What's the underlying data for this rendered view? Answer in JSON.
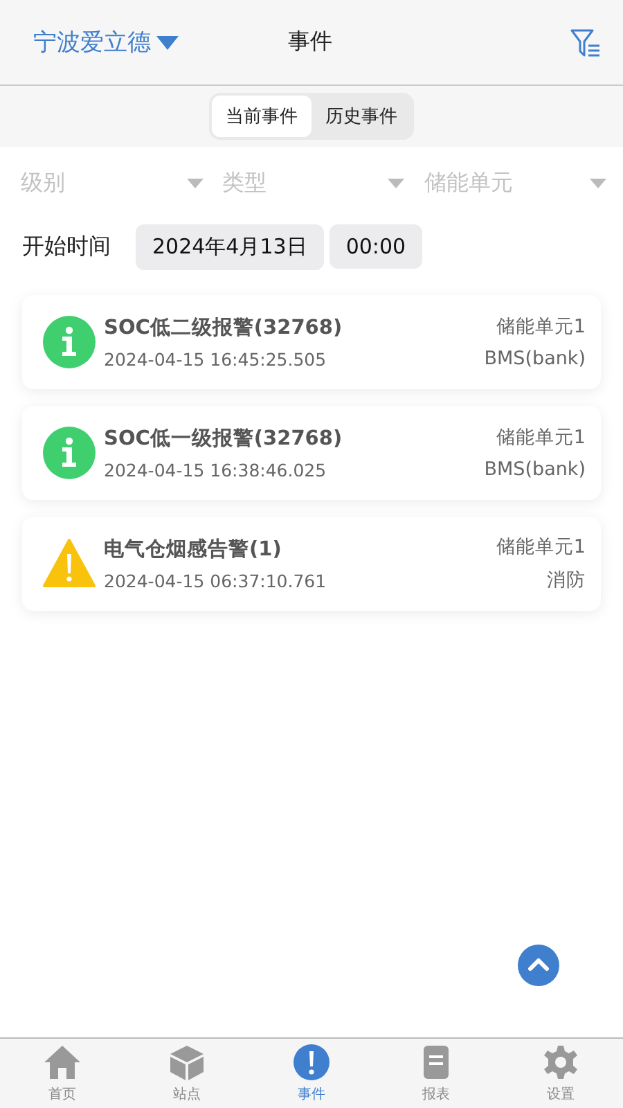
{
  "header": {
    "site": "宁波爱立德",
    "title": "事件"
  },
  "segments": [
    {
      "label": "当前事件",
      "selected": true
    },
    {
      "label": "历史事件",
      "selected": false
    }
  ],
  "filters": [
    {
      "placeholder": "级别"
    },
    {
      "placeholder": "类型"
    },
    {
      "placeholder": "储能单元"
    }
  ],
  "start_time": {
    "label": "开始时间",
    "date": "2024年4月13日",
    "time": "00:00"
  },
  "events": [
    {
      "kind": "info",
      "title": "SOC低二级报警(32768)",
      "time": "2024-04-15 16:45:25.505",
      "unit": "储能单元1",
      "source": "BMS(bank)"
    },
    {
      "kind": "info",
      "title": "SOC低一级报警(32768)",
      "time": "2024-04-15 16:38:46.025",
      "unit": "储能单元1",
      "source": "BMS(bank)"
    },
    {
      "kind": "warning",
      "title": "电气仓烟感告警(1)",
      "time": "2024-04-15 06:37:10.761",
      "unit": "储能单元1",
      "source": "消防"
    }
  ],
  "tab_bar": [
    {
      "kind": "home",
      "label": "首页",
      "selected": false
    },
    {
      "kind": "station",
      "label": "站点",
      "selected": false
    },
    {
      "kind": "event",
      "label": "事件",
      "selected": true
    },
    {
      "kind": "report",
      "label": "报表",
      "selected": false
    },
    {
      "kind": "settings",
      "label": "设置",
      "selected": false
    }
  ]
}
